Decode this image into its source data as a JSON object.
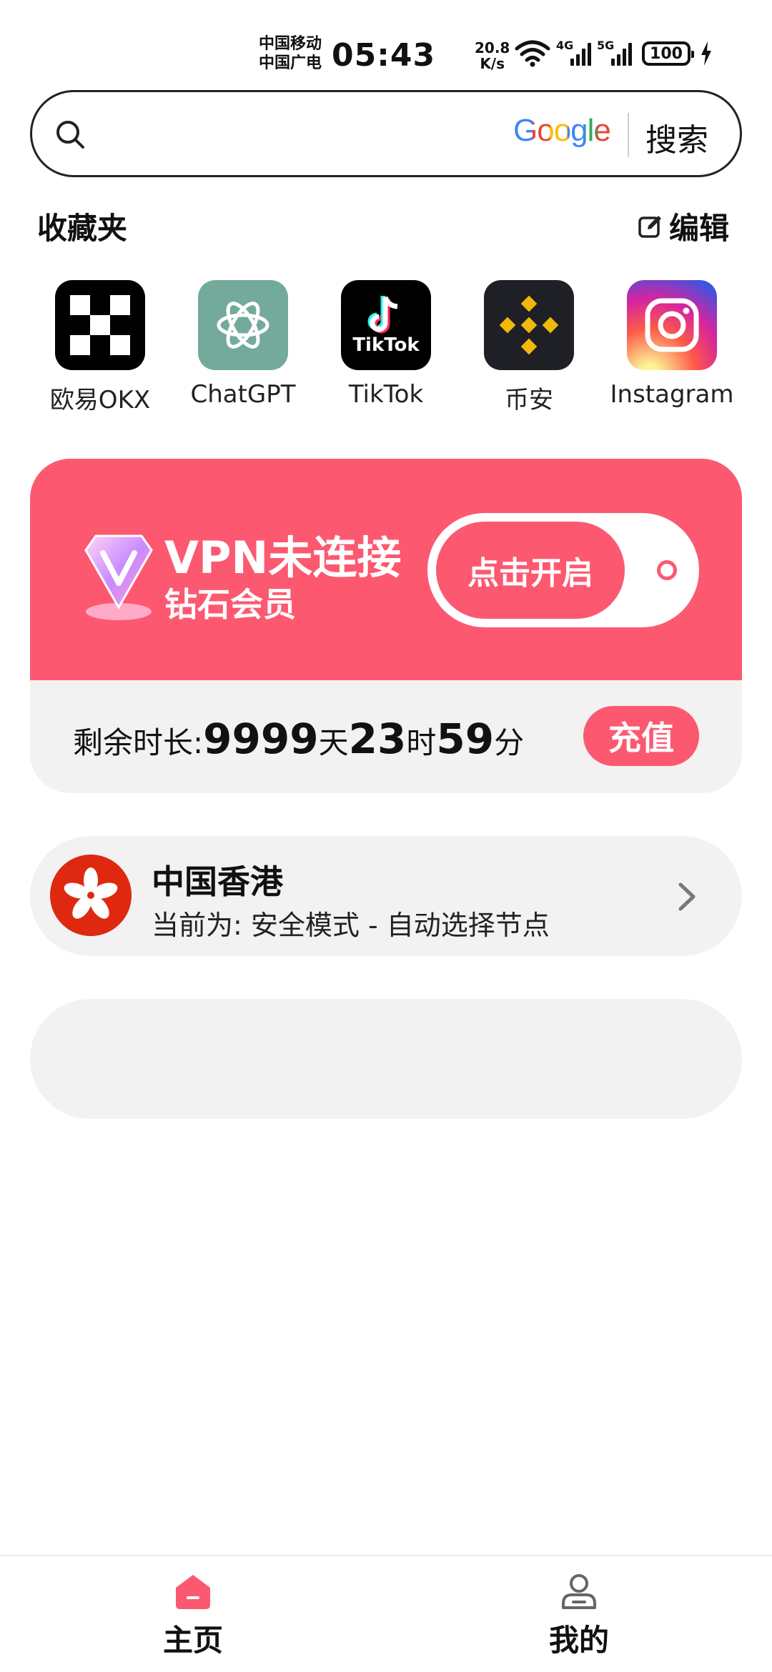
{
  "status_bar": {
    "carrier_1": "中国移动",
    "carrier_2": "中国广电",
    "time": "05:43",
    "speed_value": "20.8",
    "speed_unit": "K/s",
    "net_4g": "4G",
    "net_5g": "5G",
    "battery": "100"
  },
  "search": {
    "placeholder": "",
    "provider": "Google",
    "button_label": "搜索"
  },
  "favorites": {
    "title": "收藏夹",
    "edit_label": "编辑",
    "items": [
      {
        "label": "欧易OKX",
        "icon": "okx-icon"
      },
      {
        "label": "ChatGPT",
        "icon": "chatgpt-icon"
      },
      {
        "label": "TikTok",
        "icon": "tiktok-icon"
      },
      {
        "label": "币安",
        "icon": "binance-icon"
      },
      {
        "label": "Instagram",
        "icon": "instagram-icon"
      }
    ],
    "tiktok_word": "TikTok"
  },
  "vpn": {
    "status": "VPN未连接",
    "member": "钻石会员",
    "toggle_label": "点击开启",
    "remaining_label": "剩余时长:",
    "days_value": "9999",
    "days_unit": "天",
    "hours_value": "23",
    "hours_unit": "时",
    "minutes_value": "59",
    "minutes_unit": "分",
    "recharge_label": "充值",
    "accent": "#fc5971"
  },
  "node": {
    "name": "中国香港",
    "mode": "当前为: 安全模式 - 自动选择节点",
    "flag_icon": "hong-kong-flag-icon"
  },
  "nav": {
    "home_label": "主页",
    "me_label": "我的"
  }
}
